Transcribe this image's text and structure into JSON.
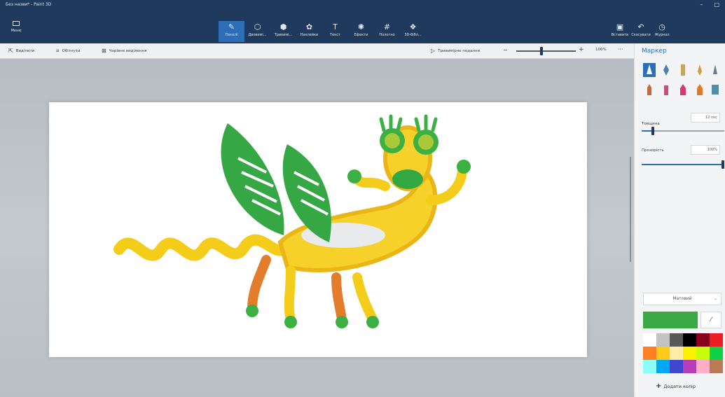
{
  "window": {
    "title": "Без назви* - Paint 3D",
    "controls": [
      "–",
      "□"
    ]
  },
  "menu": {
    "label": "Меню"
  },
  "toolbar": {
    "tools": [
      {
        "label": "Пензлі",
        "icon": "brush-icon",
        "glyph": "✎",
        "active": true
      },
      {
        "label": "Двовимі...",
        "icon": "shapes-2d-icon",
        "glyph": "⬡",
        "active": false
      },
      {
        "label": "Тривимі...",
        "icon": "shapes-3d-icon",
        "glyph": "⬢",
        "active": false
      },
      {
        "label": "Наклейки",
        "icon": "stickers-icon",
        "glyph": "✿",
        "active": false
      },
      {
        "label": "Текст",
        "icon": "text-icon",
        "glyph": "T",
        "active": false
      },
      {
        "label": "Ефекти",
        "icon": "effects-icon",
        "glyph": "✺",
        "active": false
      },
      {
        "label": "Полотно",
        "icon": "canvas-icon",
        "glyph": "#",
        "active": false
      },
      {
        "label": "3D-бібл...",
        "icon": "library-3d-icon",
        "glyph": "❖",
        "active": false
      }
    ],
    "right_tools": [
      {
        "label": "Вставити",
        "icon": "paste-icon",
        "glyph": "▣"
      },
      {
        "label": "Скасувати",
        "icon": "undo-icon",
        "glyph": "↶"
      },
      {
        "label": "Журнал",
        "icon": "history-icon",
        "glyph": "◷"
      }
    ]
  },
  "subbar": {
    "select": "Виділити",
    "crop": "Обітнути",
    "magic_select": "Чарівне виділення",
    "view_3d": "Тривимірне подання",
    "zoom_value": "100%",
    "zoom_more": "···"
  },
  "panel": {
    "title": "Маркер",
    "thickness_label": "Товщина",
    "thickness_value": "12 пкс",
    "opacity_label": "Прозорість",
    "opacity_value": "100%",
    "finish": "Матовий",
    "add_color": "Додати колір"
  },
  "colors": {
    "current": "#3aa843",
    "palette": [
      "#ffffff",
      "#c3c3c3",
      "#585858",
      "#000000",
      "#88001b",
      "#ec1c24",
      "#ff7f27",
      "#ffca18",
      "#fdeca6",
      "#fff200",
      "#c4ff0e",
      "#0ed145",
      "#8cfffb",
      "#00a8f3",
      "#3f48cc",
      "#b83dba",
      "#ffaec8",
      "#b97a56"
    ]
  }
}
